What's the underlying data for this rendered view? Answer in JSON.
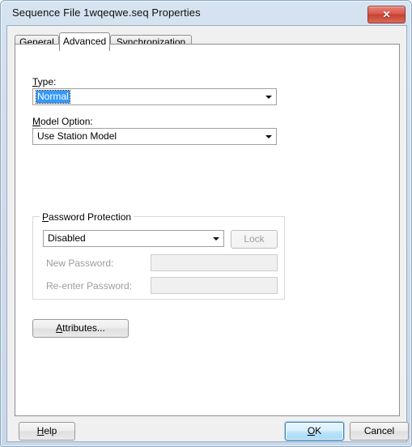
{
  "window": {
    "title": "Sequence File 1wqeqwe.seq Properties",
    "close_glyph": "✕",
    "frame_color": "#cfdceb",
    "client_color": "#f0f0f0"
  },
  "tabs": [
    {
      "label": "General",
      "selected": false
    },
    {
      "label": "Advanced",
      "selected": true
    },
    {
      "label": "Synchronization",
      "selected": false
    }
  ],
  "advanced": {
    "type": {
      "label_prefix": "T",
      "label_rest": "ype:",
      "label": "Type:",
      "value": "Normal",
      "selected": true
    },
    "model_option": {
      "label_prefix": "M",
      "label_rest": "odel Option:",
      "label": "Model Option:",
      "value": "Use Station Model",
      "selected": false
    },
    "password_group": {
      "title_prefix": "P",
      "title_rest": "assword Protection",
      "title": "Password Protection",
      "state_value": "Disabled",
      "lock_button": "Lock",
      "lock_enabled": false,
      "new_password_label": "New Password:",
      "new_password_value": "",
      "reenter_password_label": "Re-enter Password:",
      "reenter_password_value": "",
      "fields_enabled": false
    },
    "attributes_button": {
      "prefix": "A",
      "rest": "ttributes...",
      "label": "Attributes..."
    }
  },
  "footer": {
    "help": {
      "prefix": "H",
      "rest": "elp",
      "label": "Help"
    },
    "ok": {
      "prefix": "O",
      "rest": "K",
      "label": "OK",
      "is_default": true
    },
    "cancel": {
      "label": "Cancel"
    }
  },
  "colors": {
    "selection_blue": "#3399ff",
    "close_red": "#d9594e",
    "default_button_blue": "#3c7fb1"
  }
}
